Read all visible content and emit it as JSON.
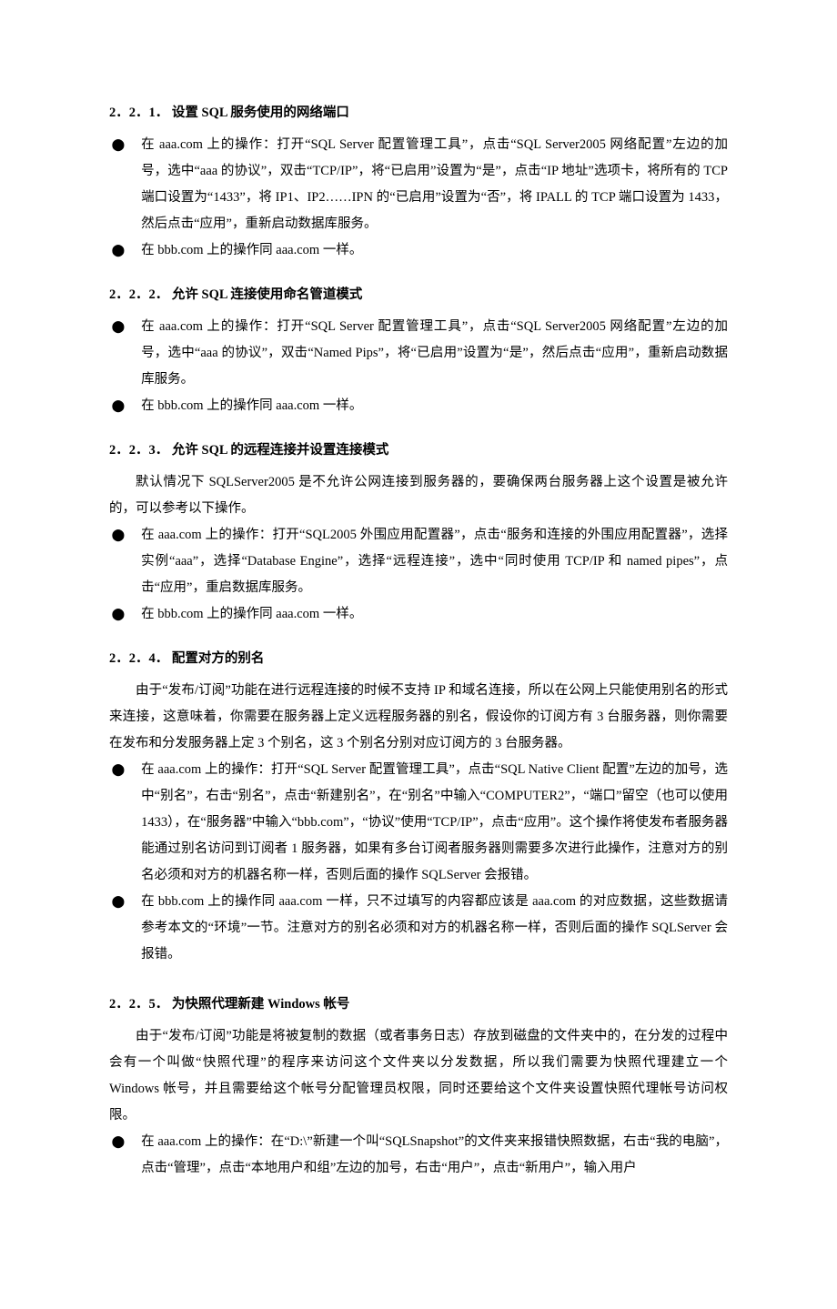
{
  "s1": {
    "heading": "2．2．1．     设置 SQL 服务使用的网络端口",
    "b1": "在 aaa.com 上的操作：打开“SQL Server 配置管理工具”，点击“SQL Server2005 网络配置”左边的加号，选中“aaa 的协议”，双击“TCP/IP”，将“已启用”设置为“是”，点击“IP 地址”选项卡，将所有的 TCP 端口设置为“1433”，将 IP1、IP2……IPN 的“已启用”设置为“否”，将 IPALL 的 TCP 端口设置为 1433，然后点击“应用”，重新启动数据库服务。",
    "b2": "在 bbb.com 上的操作同 aaa.com 一样。"
  },
  "s2": {
    "heading": "2．2．2．     允许 SQL 连接使用命名管道模式",
    "b1": "在 aaa.com 上的操作：打开“SQL Server 配置管理工具”，点击“SQL Server2005 网络配置”左边的加号，选中“aaa 的协议”，双击“Named Pips”，将“已启用”设置为“是”，然后点击“应用”，重新启动数据库服务。",
    "b2": "在 bbb.com 上的操作同 aaa.com 一样。"
  },
  "s3": {
    "heading": "2．2．3．     允许 SQL 的远程连接并设置连接模式",
    "p1": "默认情况下 SQLServer2005 是不允许公网连接到服务器的，要确保两台服务器上这个设置是被允许的，可以参考以下操作。",
    "b1": "在 aaa.com 上的操作：打开“SQL2005 外围应用配置器”，点击“服务和连接的外围应用配置器”，选择实例“aaa”，选择“Database Engine”，选择“远程连接”，选中“同时使用 TCP/IP 和 named pipes”，点击“应用”，重启数据库服务。",
    "b2": "在 bbb.com 上的操作同 aaa.com 一样。"
  },
  "s4": {
    "heading": "2．2．4．     配置对方的别名",
    "p1": "由于“发布/订阅”功能在进行远程连接的时候不支持 IP 和域名连接，所以在公网上只能使用别名的形式来连接，这意味着，你需要在服务器上定义远程服务器的别名，假设你的订阅方有 3 台服务器，则你需要在发布和分发服务器上定 3 个别名，这 3 个别名分别对应订阅方的 3 台服务器。",
    "b1": "在 aaa.com 上的操作：打开“SQL Server 配置管理工具”，点击“SQL Native Client 配置”左边的加号，选中“别名”，右击“别名”，点击“新建别名”，在“别名”中输入“COMPUTER2”，“端口”留空（也可以使用 1433），在“服务器”中输入“bbb.com”，“协议”使用“TCP/IP”，点击“应用”。这个操作将使发布者服务器能通过别名访问到订阅者 1 服务器，如果有多台订阅者服务器则需要多次进行此操作，注意对方的别名必须和对方的机器名称一样，否则后面的操作 SQLServer 会报错。",
    "b2": "在 bbb.com 上的操作同 aaa.com 一样，只不过填写的内容都应该是 aaa.com 的对应数据，这些数据请参考本文的“环境”一节。注意对方的别名必须和对方的机器名称一样，否则后面的操作 SQLServer 会报错。"
  },
  "s5": {
    "heading": "2．2．5．     为快照代理新建 Windows 帐号",
    "p1": "由于“发布/订阅”功能是将被复制的数据（或者事务日志）存放到磁盘的文件夹中的，在分发的过程中会有一个叫做“快照代理”的程序来访问这个文件夹以分发数据，所以我们需要为快照代理建立一个 Windows 帐号，并且需要给这个帐号分配管理员权限，同时还要给这个文件夹设置快照代理帐号访问权限。",
    "b1": "在 aaa.com 上的操作：在“D:\\”新建一个叫“SQLSnapshot”的文件夹来报错快照数据，右击“我的电脑”，点击“管理”，点击“本地用户和组”左边的加号，右击“用户”，点击“新用户”，输入用户"
  },
  "bullet": "⬤"
}
